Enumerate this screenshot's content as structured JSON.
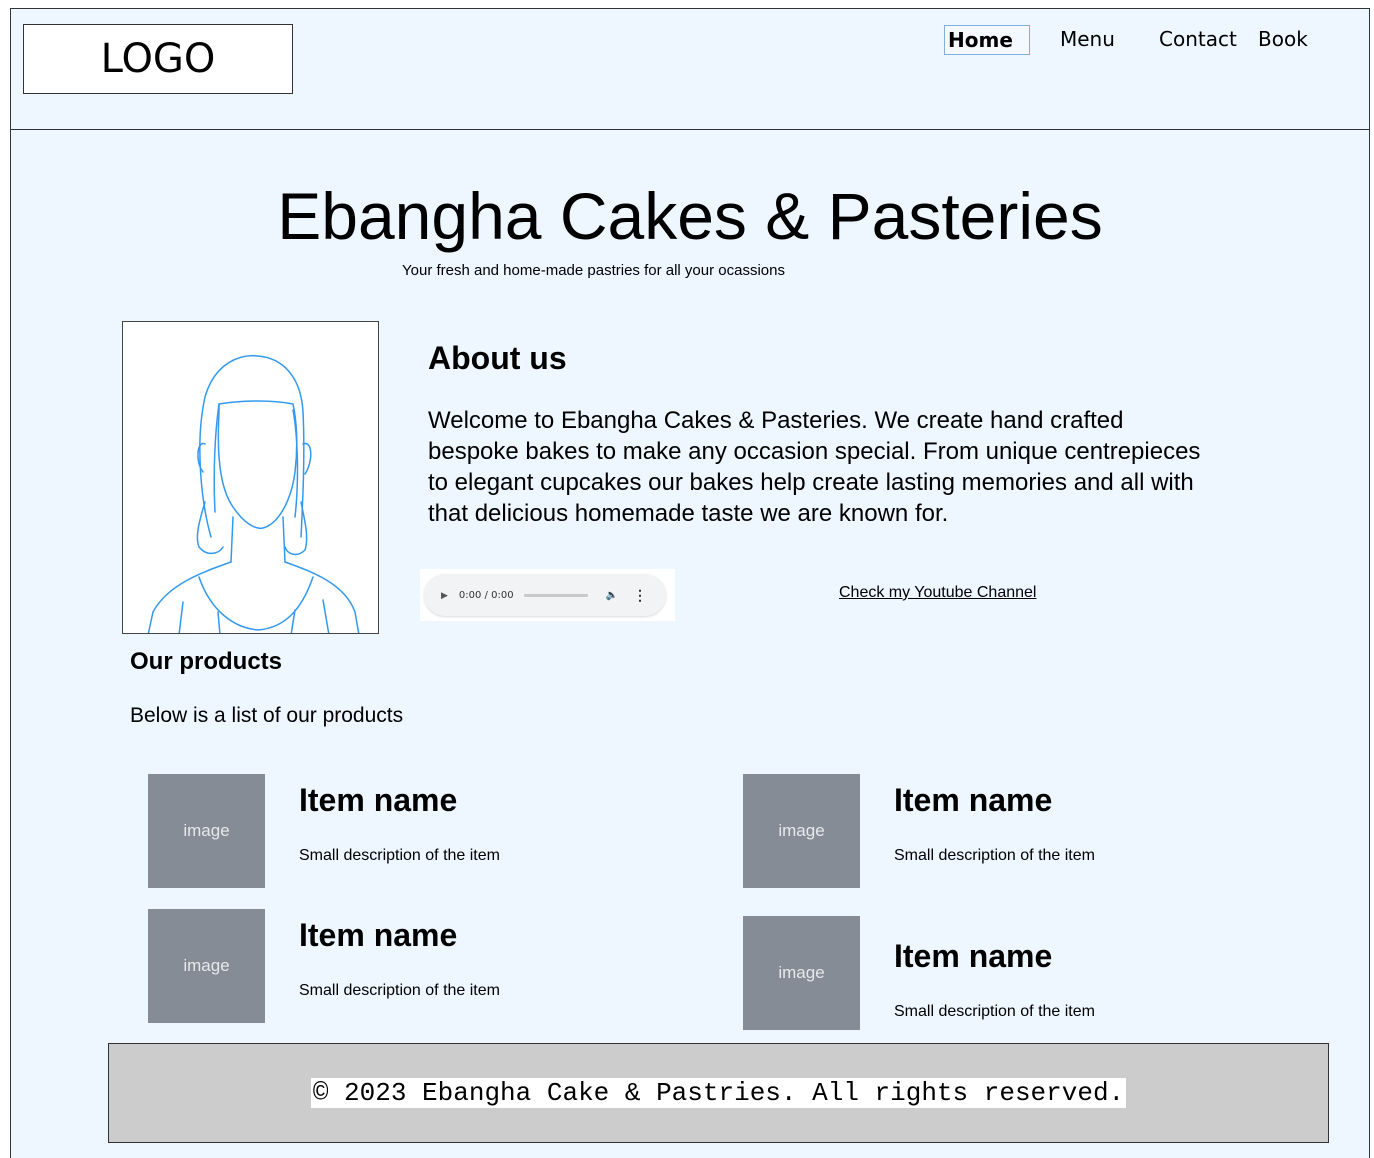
{
  "header": {
    "logo_text": "LOGO",
    "nav": [
      {
        "label": "Home",
        "active": true
      },
      {
        "label": "Menu",
        "active": false
      },
      {
        "label": "Contact",
        "active": false
      },
      {
        "label": "Book",
        "active": false
      }
    ]
  },
  "hero": {
    "title": "Ebangha Cakes & Pasteries",
    "subtitle": "Your fresh and home-made pastries for all your ocassions"
  },
  "about": {
    "heading": "About us",
    "text": "Welcome to Ebangha Cakes & Pasteries.  We create hand crafted bespoke bakes to make any occasion special. From unique centrepieces to elegant cupcakes our bakes help create lasting memories and all with that delicious homemade taste we are known for.",
    "portrait_icon": "woman-portrait-icon",
    "audio": {
      "time": "0:00 / 0:00"
    },
    "youtube_link": "Check my Youtube Channel"
  },
  "products": {
    "heading": "Our products",
    "intro": "Below is a list of our products",
    "items": [
      {
        "image_label": "image",
        "name": "Item name",
        "description": "Small description of the item"
      },
      {
        "image_label": "image",
        "name": "Item name",
        "description": "Small description of the item"
      },
      {
        "image_label": "image",
        "name": "Item name",
        "description": "Small description of the item"
      },
      {
        "image_label": "image",
        "name": "Item name",
        "description": "Small description of the item"
      }
    ]
  },
  "footer": {
    "text": "© 2023 Ebangha Cake & Pastries. All rights reserved."
  },
  "colors": {
    "page_background": "#eef6ff",
    "image_placeholder": "#858c95",
    "footer_background": "#cccccc",
    "portrait_line": "#3399ee"
  }
}
